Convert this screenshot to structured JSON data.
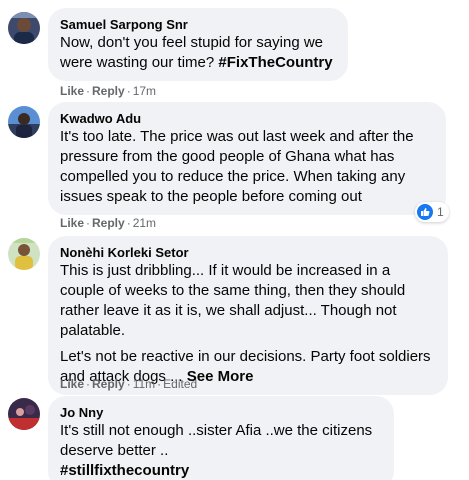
{
  "comments": [
    {
      "author": "Samuel Sarpong Snr",
      "paragraphs": [
        "Now, don't you feel stupid for saying we were wasting our time? "
      ],
      "hashtag": "#FixTheCountry",
      "like": "Like",
      "reply": "Reply",
      "time": "17m"
    },
    {
      "author": "Kwadwo Adu",
      "paragraphs": [
        "It's too late. The price was out last week and after the pressure from the good people of Ghana what has compelled you to reduce the price. When taking any issues speak to the people before coming out"
      ],
      "like": "Like",
      "reply": "Reply",
      "time": "21m",
      "reaction_count": "1"
    },
    {
      "author": "Nonèhi Korleki Setor",
      "paragraphs": [
        "This is just dribbling... If it would be increased in a couple of weeks to the same thing, then they should rather leave it as it is, we shall adjust... Though not palatable.",
        "Let's not be reactive in our decisions. Party foot soldiers and attack dogs ... "
      ],
      "see_more": "See More",
      "like": "Like",
      "reply": "Reply",
      "time": "11m",
      "edited": "Edited"
    },
    {
      "author": "Jo Nny",
      "paragraphs": [
        "It's still not enough ..sister Afia ..we the citizens deserve better .."
      ],
      "hashtag": "#stillfixthecountry"
    }
  ],
  "colors": {
    "bubble": "#f0f2f5",
    "meta": "#65676b",
    "like_blue": "#1877f2"
  }
}
